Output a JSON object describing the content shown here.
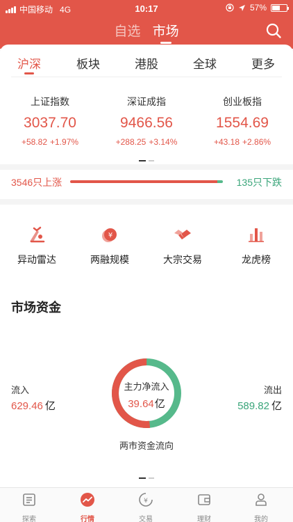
{
  "status_bar": {
    "carrier": "中国移动",
    "network": "4G",
    "time": "10:17",
    "battery": "57%",
    "battery_level": 0.57
  },
  "header": {
    "tabs": [
      {
        "label": "自选",
        "active": false
      },
      {
        "label": "市场",
        "active": true
      }
    ],
    "search_icon": "search-icon"
  },
  "sub_tabs": [
    {
      "label": "沪深",
      "active": true
    },
    {
      "label": "板块",
      "active": false
    },
    {
      "label": "港股",
      "active": false
    },
    {
      "label": "全球",
      "active": false
    },
    {
      "label": "更多",
      "active": false
    }
  ],
  "indices": [
    {
      "name": "上证指数",
      "value": "3037.70",
      "change": "+58.82",
      "pct": "+1.97%"
    },
    {
      "name": "深证成指",
      "value": "9466.56",
      "change": "+288.25",
      "pct": "+3.14%"
    },
    {
      "name": "创业板指",
      "value": "1554.69",
      "change": "+43.18",
      "pct": "+2.86%"
    }
  ],
  "breadth": {
    "up_label": "3546只上涨",
    "down_label": "135只下跌",
    "up_count": 3546,
    "down_count": 135
  },
  "tools": [
    {
      "label": "异动雷达",
      "icon": "radar-icon"
    },
    {
      "label": "两融规模",
      "icon": "coin-icon"
    },
    {
      "label": "大宗交易",
      "icon": "handshake-icon"
    },
    {
      "label": "龙虎榜",
      "icon": "bar-chart-icon"
    }
  ],
  "market_funds": {
    "title": "市场资金",
    "inflow_label": "流入",
    "inflow_value": "629.46",
    "inflow_unit": "亿",
    "outflow_label": "流出",
    "outflow_value": "589.82",
    "outflow_unit": "亿",
    "net_label": "主力净流入",
    "net_value": "39.64",
    "net_unit": "亿",
    "caption": "两市资金流向",
    "inflow_amount": 629.46,
    "outflow_amount": 589.82
  },
  "colors": {
    "brand": "#e25649",
    "up": "#e25649",
    "down": "#3aa57a",
    "down_light": "#56b98b"
  },
  "tabbar": [
    {
      "label": "探索",
      "icon": "explore-icon",
      "active": false
    },
    {
      "label": "行情",
      "icon": "market-icon",
      "active": true
    },
    {
      "label": "交易",
      "icon": "trade-icon",
      "active": false
    },
    {
      "label": "理财",
      "icon": "wallet-icon",
      "active": false
    },
    {
      "label": "我的",
      "icon": "profile-icon",
      "active": false
    }
  ]
}
